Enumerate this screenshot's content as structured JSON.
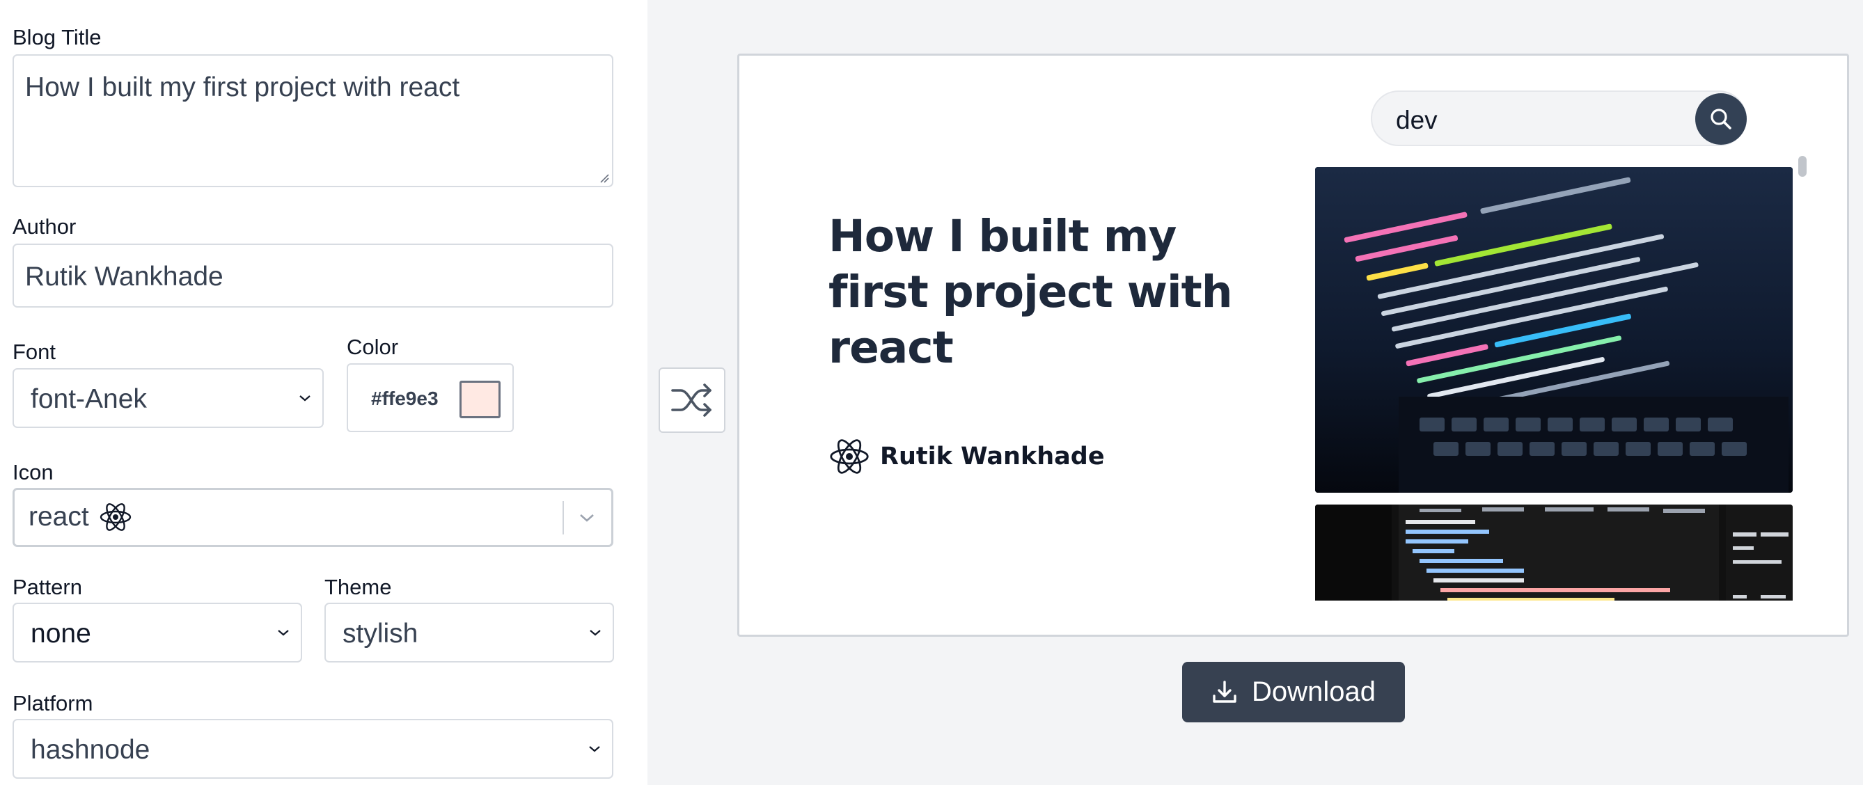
{
  "form": {
    "title_label": "Blog Title",
    "title_value": "How I built my first project with react",
    "author_label": "Author",
    "author_value": "Rutik Wankhade",
    "font_label": "Font",
    "font_value": "font-Anek",
    "color_label": "Color",
    "color_value": "#ffe9e3",
    "icon_label": "Icon",
    "icon_value": "react",
    "icon_name": "react-atom-icon",
    "pattern_label": "Pattern",
    "pattern_value": "none",
    "theme_label": "Theme",
    "theme_value": "stylish",
    "platform_label": "Platform",
    "platform_value": "hashnode"
  },
  "preview": {
    "cover_title": "How I built my first project with react",
    "cover_author": "Rutik Wankhade",
    "search_value": "dev",
    "results": [
      {
        "icon": "code-screenshot-image"
      },
      {
        "icon": "devtools-screenshot-image"
      }
    ]
  },
  "actions": {
    "download_label": "Download",
    "shuffle_icon": "shuffle-icon"
  },
  "colors": {
    "swatch": "#ffe9e3",
    "button_dark": "#374151",
    "search_button": "#334155",
    "panel_bg": "#f3f4f6"
  }
}
